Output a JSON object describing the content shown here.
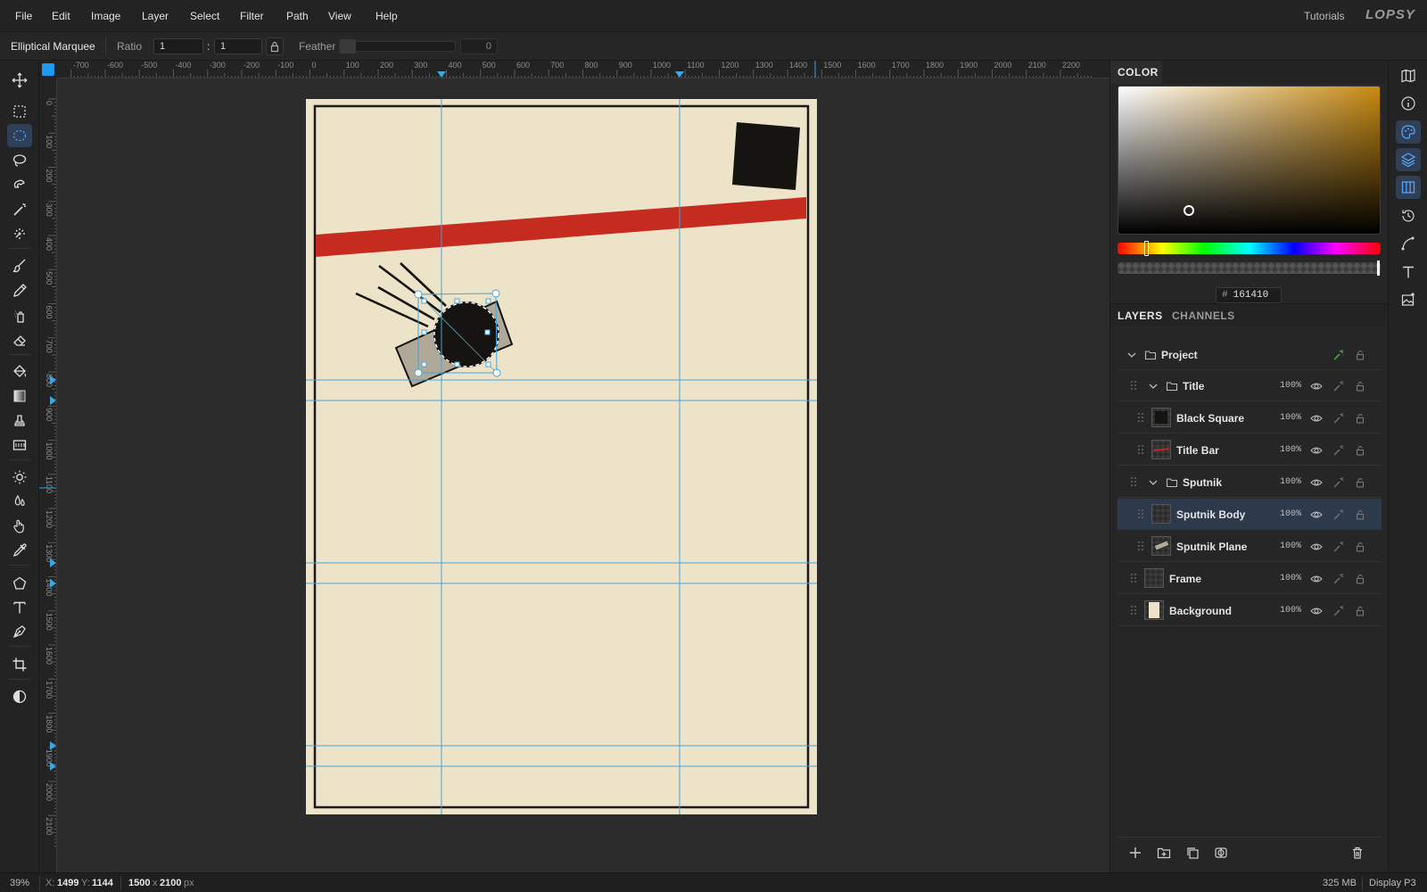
{
  "menu": {
    "items": [
      "File",
      "Edit",
      "Image",
      "Layer",
      "Select",
      "Filter",
      "Path",
      "View",
      "Help"
    ],
    "tutorials": "Tutorials",
    "brand": "LOPSY"
  },
  "options": {
    "tool_name": "Elliptical Marquee",
    "ratio_label": "Ratio",
    "ratio_w": "1",
    "ratio_colon": ":",
    "ratio_h": "1",
    "feather_label": "Feather",
    "feather_value": "0"
  },
  "rulers": {
    "h_labels": [
      "-700",
      "-600",
      "-500",
      "-400",
      "-300",
      "-200",
      "-100",
      "0",
      "100",
      "200",
      "300",
      "400",
      "500",
      "600",
      "700",
      "800",
      "900",
      "1000",
      "1100",
      "1200",
      "1300",
      "1400",
      "1500",
      "1600",
      "1700",
      "1800",
      "1900",
      "2000",
      "2100",
      "2200"
    ],
    "v_labels": [
      "0",
      "100",
      "200",
      "300",
      "400",
      "500",
      "600",
      "700",
      "800",
      "900",
      "1000",
      "1100",
      "1200",
      "1300",
      "1400",
      "1500",
      "1600",
      "1700",
      "1800",
      "1900",
      "2000",
      "2100"
    ]
  },
  "color_panel": {
    "tab": "COLOR",
    "hue_color": "#c88a12",
    "hex_hash": "#",
    "hex": "161410",
    "hue_fraction": 0.11,
    "sat_fraction": 0.26,
    "brightness_fraction": 0.2
  },
  "layers_panel": {
    "tabs": [
      "LAYERS",
      "CHANNELS"
    ],
    "rows": [
      {
        "name": "Project",
        "kind": "group-root",
        "opacity": ""
      },
      {
        "name": "Title",
        "kind": "group",
        "opacity": "100%"
      },
      {
        "name": "Black Square",
        "kind": "layer",
        "opacity": "100%"
      },
      {
        "name": "Title Bar",
        "kind": "layer",
        "opacity": "100%"
      },
      {
        "name": "Sputnik",
        "kind": "group",
        "opacity": "100%"
      },
      {
        "name": "Sputnik Body",
        "kind": "layer",
        "opacity": "100%",
        "selected": true
      },
      {
        "name": "Sputnik Plane",
        "kind": "layer",
        "opacity": "100%"
      },
      {
        "name": "Frame",
        "kind": "layer",
        "opacity": "100%"
      },
      {
        "name": "Background",
        "kind": "layer",
        "opacity": "100%"
      }
    ]
  },
  "document": {
    "paper_color": "#ece3c9",
    "bar_color": "#c62b20",
    "ink_color": "#161410",
    "guide_color": "#3fa6dc"
  },
  "status": {
    "zoom": "39%",
    "x_label": "X:",
    "x_value": "1499",
    "y_label": "Y:",
    "y_value": "1144",
    "doc_w": "1500",
    "doc_x": "x",
    "doc_h": "2100",
    "doc_unit": "px",
    "memory": "325 MB",
    "profile": "Display P3"
  }
}
